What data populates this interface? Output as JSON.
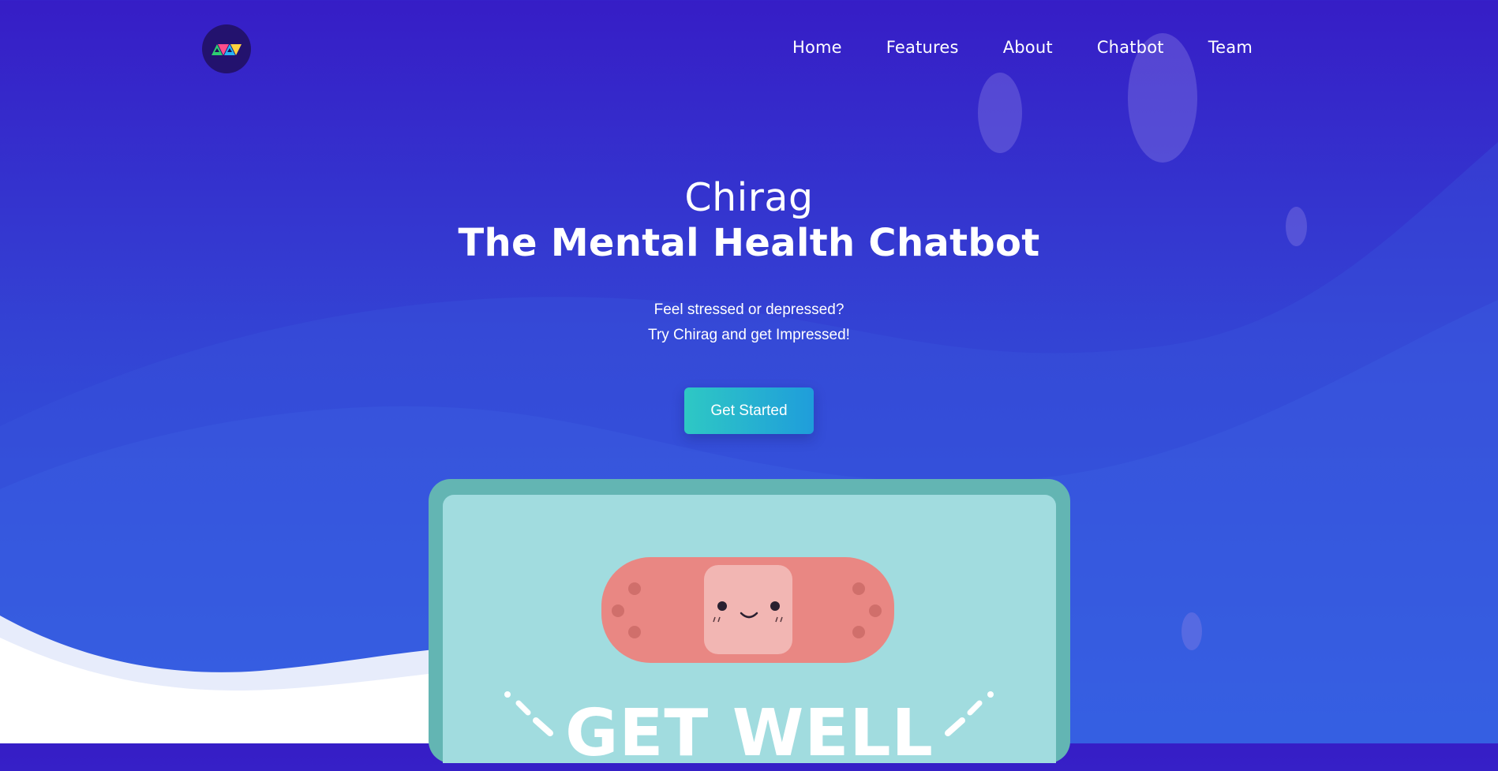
{
  "nav": {
    "logo_alt": "logo",
    "items": [
      {
        "label": "Home"
      },
      {
        "label": "Features"
      },
      {
        "label": "About"
      },
      {
        "label": "Chatbot"
      },
      {
        "label": "Team"
      }
    ]
  },
  "hero": {
    "title_top": "Chirag",
    "title_main": "The Mental Health Chatbot",
    "subtitle_line1": "Feel stressed or depressed?",
    "subtitle_line2": "Try Chirag and get Impressed!",
    "cta_label": "Get Started"
  },
  "illustration": {
    "caption": "GET WELL"
  },
  "colors": {
    "bg_top": "#361dc6",
    "bg_bottom": "#2f62e3",
    "cta_start": "#2ec8c4",
    "cta_end": "#1f9ddb",
    "card_border": "#63b5b3",
    "card_fill": "#a1dcdf",
    "bandage": "#e98783",
    "bandage_pad": "#f2b6b3"
  }
}
